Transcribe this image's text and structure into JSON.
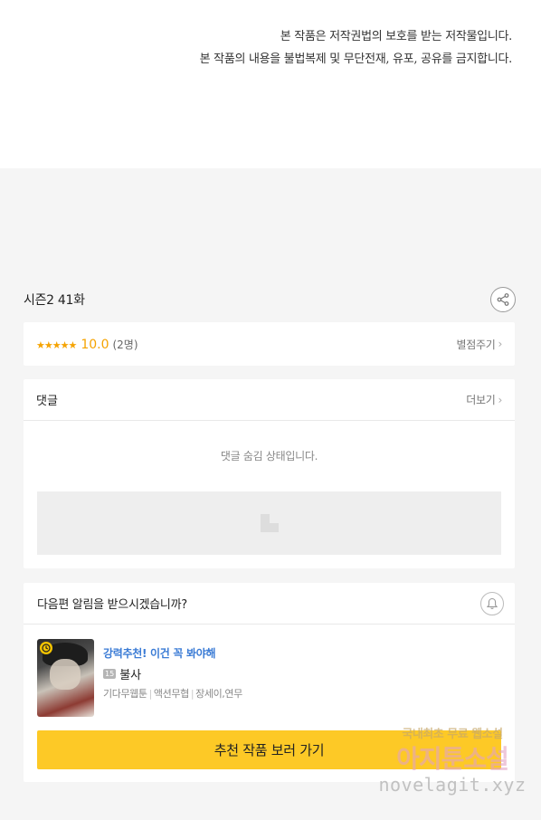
{
  "copyright_notice": {
    "line1": "본 작품은 저작권법의 보호를 받는 저작물입니다.",
    "line2": "본 작품의 내용을 불법복제 및 무단전재, 유포, 공유를 금지합니다."
  },
  "episode": {
    "title": "시즌2 41화"
  },
  "rating": {
    "stars": "★★★★★",
    "score": "10.0",
    "votes": "(2명)",
    "rate_link": "별점주기",
    "chevron": "›"
  },
  "comments": {
    "title": "댓글",
    "more_link": "더보기",
    "chevron": "›",
    "hidden_message": "댓글 숨김 상태입니다."
  },
  "notification": {
    "question": "다음편 알림을 받으시겠습니까?"
  },
  "recommendation": {
    "tag": "강력추천! 이건 꼭 봐야해",
    "age_badge": "15",
    "title": "불사",
    "meta": [
      "기다무웹툰",
      "액션무협",
      "장세이,연무"
    ],
    "meta_sep": "|",
    "button_label": "추천 작품 보러 가기"
  },
  "watermark": {
    "top": "국내최초 무료 웹소설",
    "mid": "아지툰소설",
    "bottom": "novelagit.xyz"
  },
  "colors": {
    "accent_yellow": "#fdc926",
    "star_orange": "#f5a300",
    "tag_blue": "#3a7bd5"
  }
}
